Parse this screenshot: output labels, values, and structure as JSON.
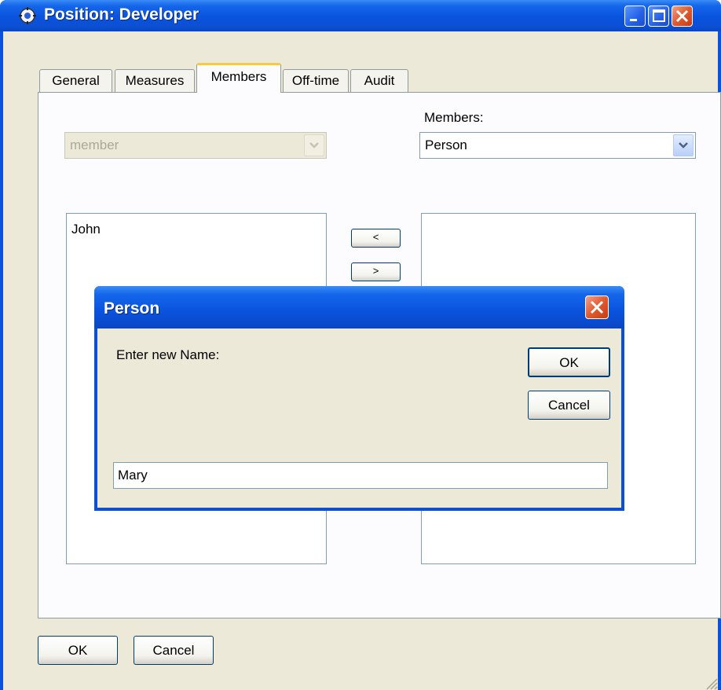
{
  "window": {
    "title": "Position: Developer",
    "icons": {
      "app": "app-icon",
      "minimize": "minimize-icon",
      "maximize": "maximize-icon",
      "close": "close-icon"
    }
  },
  "tabs": [
    {
      "label": "General",
      "active": false
    },
    {
      "label": "Measures",
      "active": false
    },
    {
      "label": "Members",
      "active": true
    },
    {
      "label": "Off-time",
      "active": false
    },
    {
      "label": "Audit",
      "active": false
    }
  ],
  "members_panel": {
    "left_combo_value": "member",
    "right_label": "Members:",
    "right_combo_value": "Person",
    "left_list": [
      "John"
    ],
    "right_list": [],
    "move_left_label": "<",
    "move_right_label": ">"
  },
  "footer": {
    "ok_label": "OK",
    "cancel_label": "Cancel"
  },
  "dialog": {
    "title": "Person",
    "prompt": "Enter new Name:",
    "ok_label": "OK",
    "cancel_label": "Cancel",
    "input_value": "Mary"
  },
  "colors": {
    "titlebar": "#0a53dd",
    "window_face": "#ece9d8",
    "tab_highlight": "#ffc83c",
    "close_button": "#e05a30"
  }
}
